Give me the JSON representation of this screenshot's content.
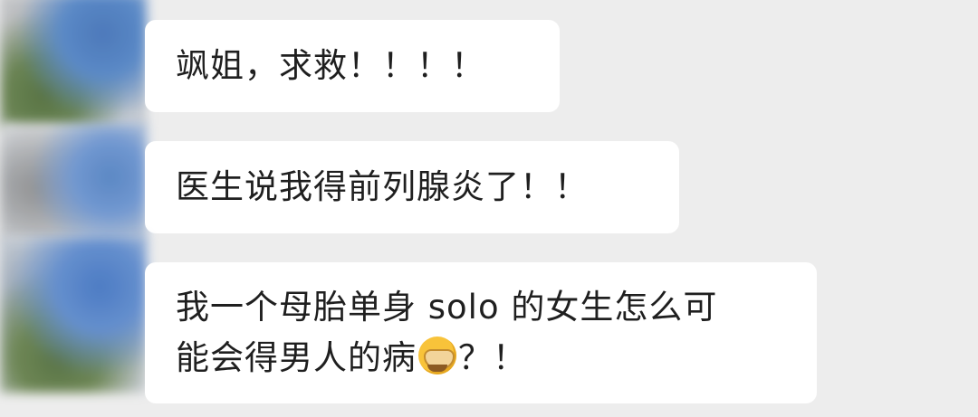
{
  "messages": [
    {
      "text": "飒姐，求救！！！！",
      "sender_avatar": "blurred-avatar"
    },
    {
      "text": "医生说我得前列腺炎了！！",
      "sender_avatar": "blurred-avatar"
    },
    {
      "line1": "我一个母胎单身 solo 的女生怎么可",
      "line2_before_emoji": "能会得男人的病",
      "emoji": "face-palm-emoji",
      "line2_after_emoji": "？！",
      "sender_avatar": "blurred-avatar"
    }
  ],
  "colors": {
    "background": "#ededed",
    "bubble": "#ffffff",
    "text": "#1f1f1f"
  }
}
